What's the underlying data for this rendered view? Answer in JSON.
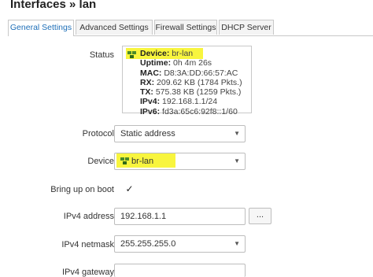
{
  "page": {
    "title": "Interfaces » lan"
  },
  "tabs": [
    {
      "label": "General Settings",
      "active": true
    },
    {
      "label": "Advanced Settings",
      "active": false
    },
    {
      "label": "Firewall Settings",
      "active": false
    },
    {
      "label": "DHCP Server",
      "active": false
    }
  ],
  "status": {
    "label": "Status",
    "lines": [
      {
        "key": "Device:",
        "value": "br-lan"
      },
      {
        "key": "Uptime:",
        "value": "0h 4m 26s"
      },
      {
        "key": "MAC:",
        "value": "D8:3A:DD:66:57:AC"
      },
      {
        "key": "RX:",
        "value": "209.62 KB (1784 Pkts.)"
      },
      {
        "key": "TX:",
        "value": "575.38 KB (1259 Pkts.)"
      },
      {
        "key": "IPv4:",
        "value": "192.168.1.1/24"
      },
      {
        "key": "IPv6:",
        "value": "fd3a:65c6:92f8::1/60"
      }
    ]
  },
  "protocol": {
    "label": "Protocol",
    "value": "Static address"
  },
  "device": {
    "label": "Device",
    "value": "br-lan"
  },
  "boot": {
    "label": "Bring up on boot",
    "checked": true,
    "mark": "✓"
  },
  "ipv4_address": {
    "label": "IPv4 address",
    "value": "192.168.1.1",
    "button": "..."
  },
  "ipv4_netmask": {
    "label": "IPv4 netmask",
    "value": "255.255.255.0"
  },
  "ipv4_gateway": {
    "label": "IPv4 gateway",
    "value": ""
  },
  "colors": {
    "accent": "#1e6fb8",
    "highlight": "#f7f31c",
    "icon": "#4a8a2a"
  },
  "icons": {
    "device": "network-device-icon",
    "dropdown": "chevron-down-icon"
  }
}
